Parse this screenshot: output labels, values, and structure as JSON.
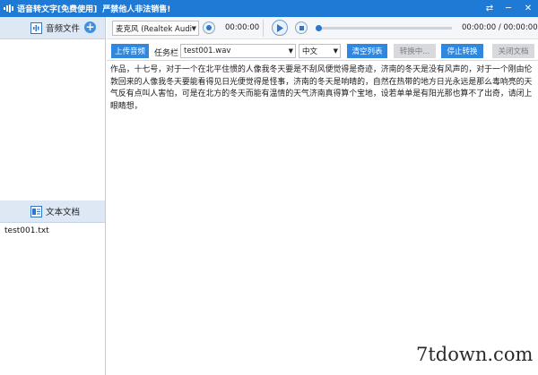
{
  "titlebar": {
    "title": "语音转文字[免费使用]",
    "warning": "严禁他人非法销售!",
    "controls": [
      "⇄",
      "─",
      "✕"
    ]
  },
  "left_panel": {
    "audio_header": "音频文件",
    "text_header": "文本文档",
    "text_files": [
      "test001.txt"
    ]
  },
  "player": {
    "mic_device": "麦克风 (Realtek Audi",
    "record_time": "00:00:00",
    "play_time": "00:00:00 / 00:00:00",
    "progress": 0
  },
  "toolbar": {
    "upload_label": "上传音频",
    "task_label": "任务栏",
    "task_file": "test001.wav",
    "language": "中文",
    "clear_label": "清空列表",
    "converting_label": "转换中...",
    "stop_label": "停止转换",
    "close_doc_label": "关闭文档"
  },
  "document": {
    "text": "作品，十七号，对于一个在北平住惯的人像我冬天要是不刮风便觉得是奇迹，济南的冬天是没有风声的，对于一个刚由伦敦回来的人像我冬天要能看得见日光便觉得是怪事，济南的冬天是响晴的，自然在热带的地方日光永远是那么毒响亮的天气反有点叫人害怕，可是在北方的冬天而能有温情的天气济南真得算个宝地，设若单单是有阳光那也算不了出奇，请闭上眼睛想，"
  },
  "watermark": "7tdown.com",
  "colors": {
    "titlebar": "#1f7ad6",
    "accent": "#2f87df",
    "disabled": "#d7d9dc",
    "panel_header": "#dde8f4"
  },
  "icons": {
    "app": "app-logo-icon",
    "audio": "audio-file-icon",
    "text": "text-document-icon",
    "add": "plus-icon",
    "record": "record-icon",
    "play": "play-icon",
    "stop": "stop-icon"
  }
}
